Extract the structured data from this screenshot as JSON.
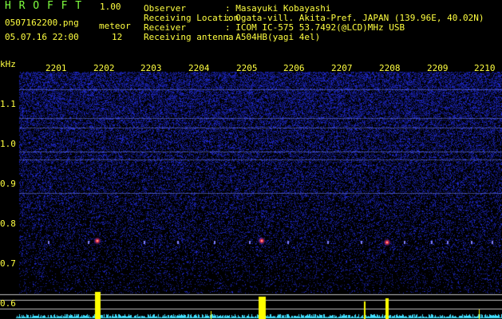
{
  "header": {
    "app_name": "H R O F F T",
    "version": "1.00",
    "filename": "0507162200.png",
    "datetime": "05.07.16 22:00",
    "meteor_label": "meteor",
    "meteor_count": "12"
  },
  "info": [
    {
      "label": "Observer",
      "value": ": Masayuki Kobayashi"
    },
    {
      "label": "Receiving Location",
      "value": ": Ogata-vill. Akita-Pref. JAPAN (139.96E, 40.02N)"
    },
    {
      "label": "Receiver",
      "value": ": ICOM IC-575 53.7492(@LCD)MHz USB"
    },
    {
      "label": "Receiving antenna",
      "value": ": A504HB(yagi 4el)"
    }
  ],
  "axis": {
    "y_unit": "kHz",
    "y_ticks": [
      "1.1",
      "1.0",
      "0.9",
      "0.8",
      "0.7",
      "0.6"
    ],
    "x_ticks": [
      "2201",
      "2202",
      "2203",
      "2204",
      "2205",
      "2206",
      "2207",
      "2208",
      "2209",
      "2210"
    ]
  },
  "colors": {
    "background": "#000000",
    "noise": "#1f1fb0",
    "header_green": "#7fff3f",
    "axis_yellow": "#ffff40",
    "meteor_red": "#ff3030",
    "baseline_cyan": "#40e0ff"
  }
}
